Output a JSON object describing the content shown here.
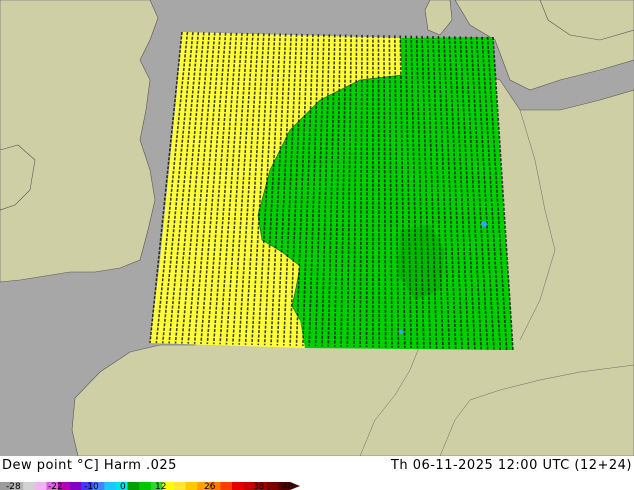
{
  "header": {
    "title_left": "Dew point °C] Harm .025",
    "title_right": "Th 06-11-2025 12:00 UTC (12+24)"
  },
  "legend": {
    "ticks": [
      "-28",
      "-22",
      "-10",
      "0",
      "12",
      "26",
      "38",
      "48"
    ],
    "colors": [
      "#9c9c9c",
      "#b4b4b4",
      "#d2d2d2",
      "#f0b4f0",
      "#dc64dc",
      "#b400b4",
      "#8000c8",
      "#3c3cff",
      "#4682ff",
      "#1ec8ff",
      "#00e6e6",
      "#00a000",
      "#00c800",
      "#32d232",
      "#ffff00",
      "#ffe632",
      "#ffc800",
      "#ffa000",
      "#ff7800",
      "#ff3c00",
      "#e60000",
      "#c80000",
      "#a00000",
      "#780000",
      "#500000"
    ]
  },
  "map": {
    "land_color": "#cfcfa6",
    "sea_color": "#a7a7a7",
    "warm_color": "#ffff3c",
    "cool_color": "#00cf00",
    "label_color": "#000000"
  }
}
